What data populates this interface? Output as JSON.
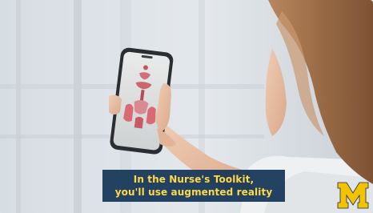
{
  "caption": {
    "line1": "In the Nurse's Toolkit,",
    "line2": "you'll use augmented reality"
  },
  "logo": {
    "letter": "M",
    "color": "#f2c300"
  }
}
